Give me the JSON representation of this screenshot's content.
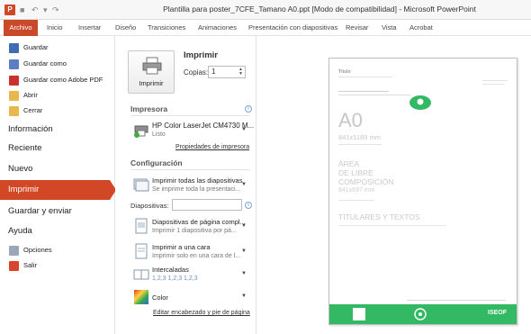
{
  "window": {
    "app_letter": "P",
    "title": "Plantilla para poster_7CFE_Tamano A0.ppt [Modo de compatibilidad] - Microsoft PowerPoint"
  },
  "ribbon_tabs": [
    "Archivo",
    "Inicio",
    "Insertar",
    "Diseño",
    "Transiciones",
    "Animaciones",
    "Presentación con diapositivas",
    "Revisar",
    "Vista",
    "Acrobat"
  ],
  "nav": {
    "guardar": "Guardar",
    "guardar_como": "Guardar como",
    "guardar_pdf": "Guardar como Adobe PDF",
    "abrir": "Abrir",
    "cerrar": "Cerrar",
    "informacion": "Información",
    "reciente": "Reciente",
    "nuevo": "Nuevo",
    "imprimir": "Imprimir",
    "guardar_enviar": "Guardar y enviar",
    "ayuda": "Ayuda",
    "opciones": "Opciones",
    "salir": "Salir"
  },
  "print": {
    "heading": "Imprimir",
    "button_label": "Imprimir",
    "copies_label": "Copias:",
    "copies_value": "1",
    "printer_section": "Impresora",
    "printer_name": "HP Color LaserJet CM4730 M...",
    "printer_status": "Listo",
    "printer_props_link": "Propiedades de impresora",
    "config_section": "Configuración",
    "option_slides_1": "Imprimir todas las diapositivas",
    "option_slides_2": "Se imprime toda la presentaci...",
    "slides_label": "Diapositivas:",
    "option_layout_1": "Diapositivas de página compl...",
    "option_layout_2": "Imprimir 1 diapositiva por pá...",
    "option_sides_1": "Imprimir a una cara",
    "option_sides_2": "Imprimir solo en una cara de l...",
    "option_collate_1": "Intercaladas",
    "option_collate_2": "1,2,3    1,2,3    1,2,3",
    "option_color": "Color",
    "edit_header_link": "Editar encabezado y pie de página"
  },
  "preview": {
    "title_line": "Título",
    "size_heading": "A0",
    "size_dims": "841x1189 mm",
    "area_line1": "ÁREA",
    "area_line2": "DE LIBRE",
    "area_line3": "COMPOSICIÓN",
    "area_dims": "841x697 mm",
    "titles_heading": "TITULARES Y TEXTOS",
    "footer_logo": "ISEOF"
  },
  "colors": {
    "accent": "#d24726",
    "poster_green": "#33b864"
  }
}
